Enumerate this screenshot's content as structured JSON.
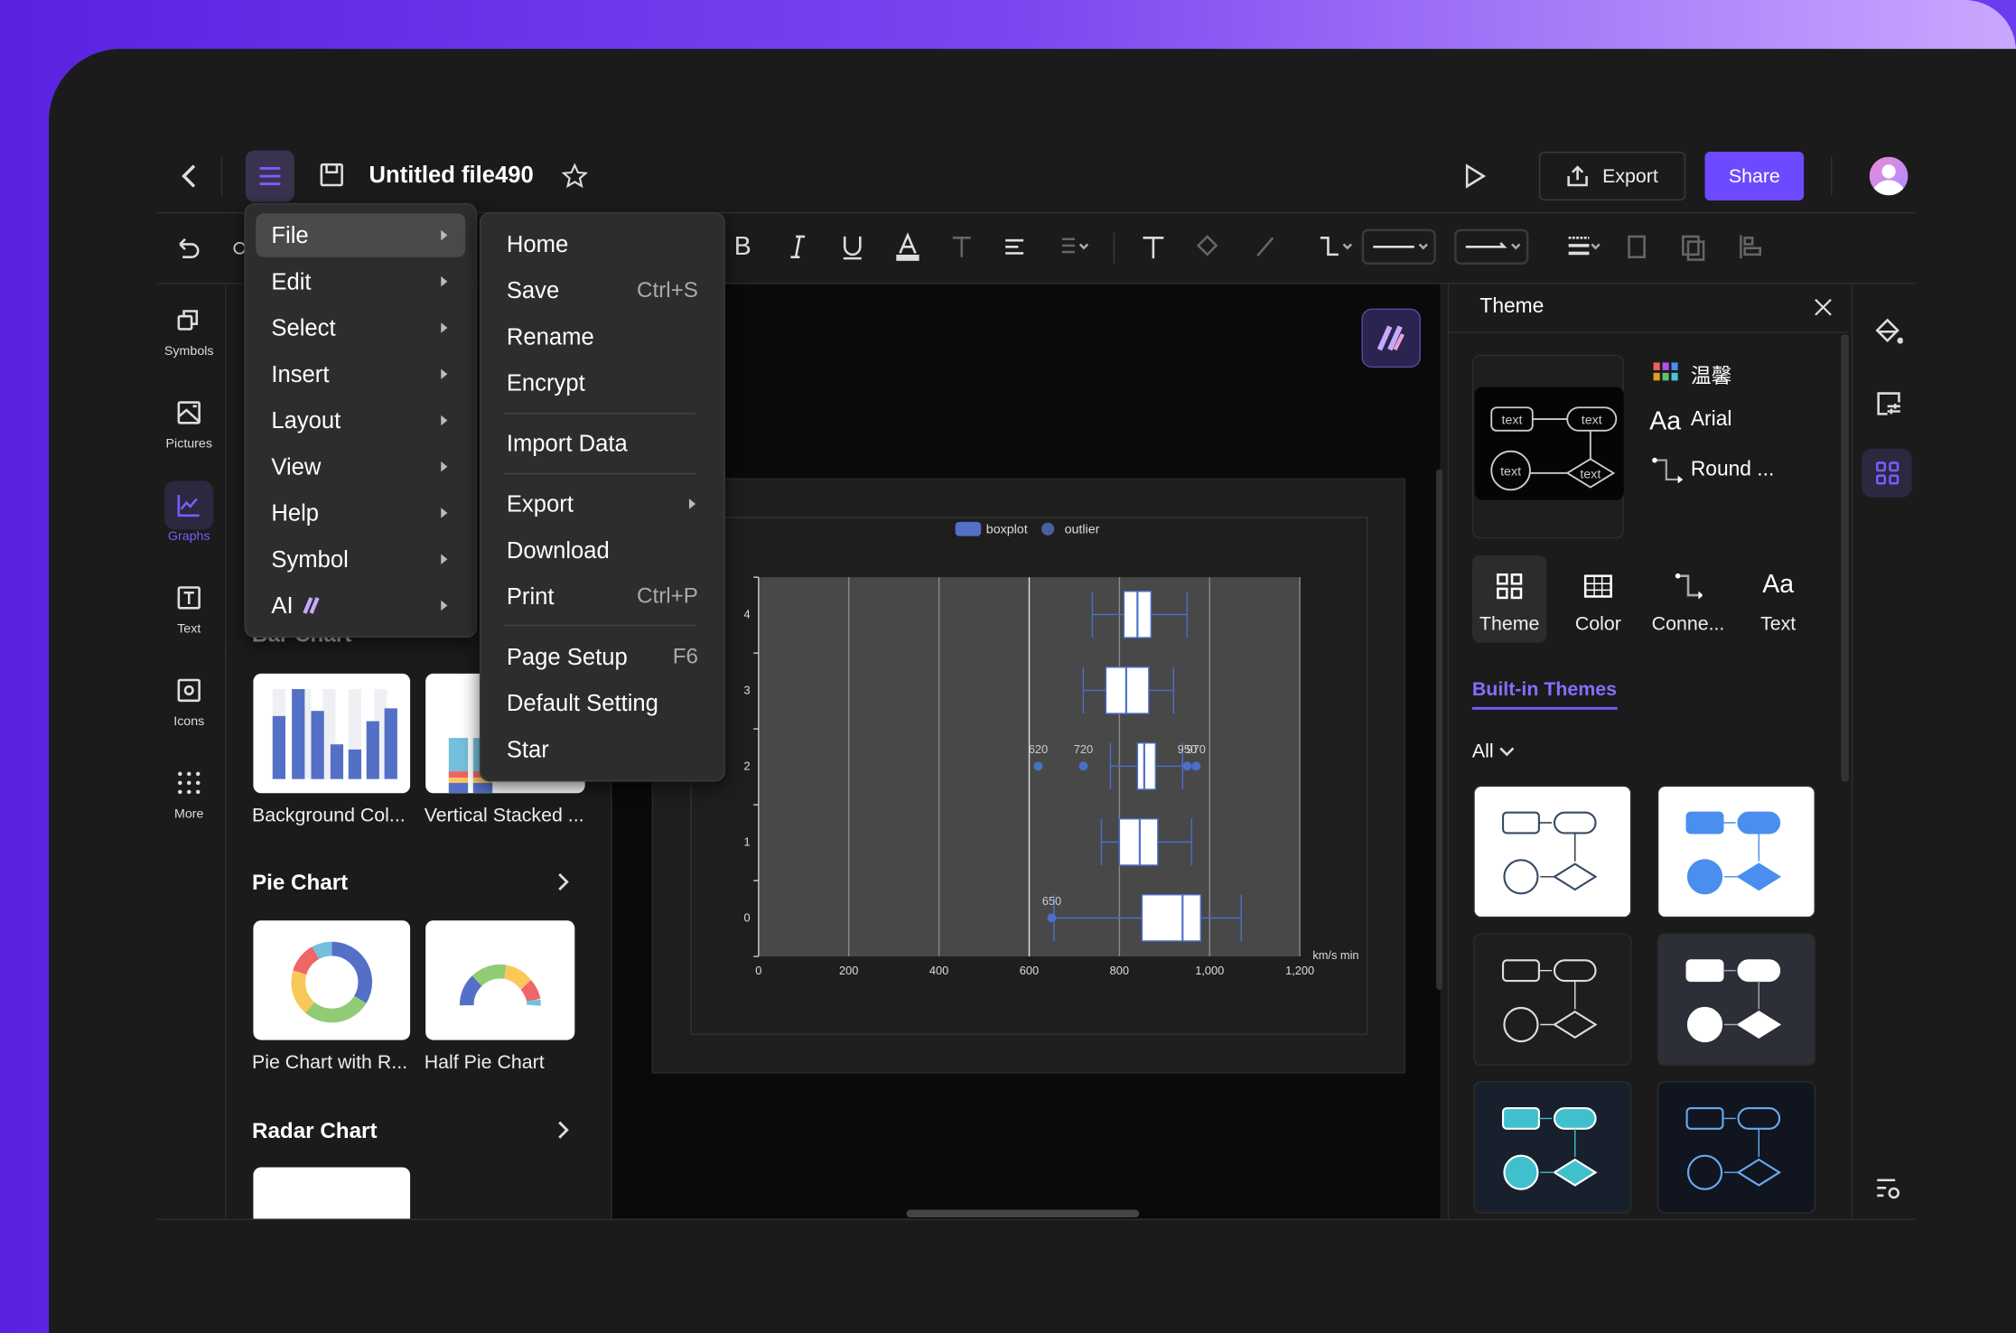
{
  "header": {
    "title": "Untitled file490",
    "export_label": "Export",
    "share_label": "Share"
  },
  "colors": {
    "accent": "#6d4aff",
    "menu_bg": "#2d2d2d",
    "canvas": "#0a0a0a",
    "plot_bg": "#484848",
    "box_stroke": "#4a6fc7",
    "outlier": "#4a6fc7"
  },
  "sidebar": {
    "items": [
      {
        "label": "Symbols",
        "icon": "symbols-icon"
      },
      {
        "label": "Pictures",
        "icon": "pictures-icon"
      },
      {
        "label": "Graphs",
        "icon": "graphs-icon",
        "active": true
      },
      {
        "label": "Text",
        "icon": "text-icon"
      },
      {
        "label": "Icons",
        "icon": "icons-icon"
      },
      {
        "label": "More",
        "icon": "more-icon"
      }
    ]
  },
  "library": {
    "bar_heading": "Bar Chart",
    "bar_items": [
      "Background Col...",
      "Vertical Stacked ..."
    ],
    "pie_heading": "Pie Chart",
    "pie_items": [
      "Pie Chart with R...",
      "Half Pie Chart"
    ],
    "radar_heading": "Radar Chart"
  },
  "main_menu": {
    "items": [
      "File",
      "Edit",
      "Select",
      "Insert",
      "Layout",
      "View",
      "Help",
      "Symbol",
      "AI"
    ],
    "highlighted": "File"
  },
  "file_menu": {
    "items": [
      {
        "label": "Home"
      },
      {
        "label": "Save",
        "shortcut": "Ctrl+S"
      },
      {
        "label": "Rename"
      },
      {
        "label": "Encrypt"
      },
      {
        "label": "Import Data"
      },
      {
        "label": "Export",
        "submenu": true
      },
      {
        "label": "Download"
      },
      {
        "label": "Print",
        "shortcut": "Ctrl+P"
      },
      {
        "label": "Page Setup",
        "shortcut": "F6"
      },
      {
        "label": "Default Setting"
      },
      {
        "label": "Star"
      }
    ]
  },
  "chart_data": {
    "type": "boxplot",
    "orientation": "horizontal",
    "legend": [
      "boxplot",
      "outlier"
    ],
    "legend_position": "top",
    "categories": [
      "0",
      "1",
      "2",
      "3",
      "4"
    ],
    "xlabel": "km/s min",
    "xlim": [
      0,
      1200
    ],
    "xticks": [
      "0",
      "200",
      "400",
      "600",
      "800",
      "1,000",
      "1,200"
    ],
    "grid": true,
    "boxes": [
      {
        "category": "0",
        "min": 655,
        "q1": 850,
        "median": 940,
        "q3": 980,
        "max": 1070
      },
      {
        "category": "1",
        "min": 760,
        "q1": 800,
        "median": 845,
        "q3": 885,
        "max": 960
      },
      {
        "category": "2",
        "min": 780,
        "q1": 840,
        "median": 855,
        "q3": 880,
        "max": 940
      },
      {
        "category": "3",
        "min": 720,
        "q1": 770,
        "median": 815,
        "q3": 865,
        "max": 920
      },
      {
        "category": "4",
        "min": 740,
        "q1": 810,
        "median": 840,
        "q3": 870,
        "max": 950
      }
    ],
    "outliers": [
      {
        "category": "0",
        "value": 650,
        "label": "650"
      },
      {
        "category": "2",
        "value": 620,
        "label": "620"
      },
      {
        "category": "2",
        "value": 720,
        "label": "720"
      },
      {
        "category": "2",
        "value": 950,
        "label": "950"
      },
      {
        "category": "2",
        "value": 970,
        "label": "970"
      }
    ]
  },
  "theme_panel": {
    "title": "Theme",
    "current_color_scheme": "温馨",
    "current_font": "Arial",
    "current_connector": "Round ...",
    "preview_node_text": "text",
    "tabs": [
      "Theme",
      "Color",
      "Conne...",
      "Text"
    ],
    "active_tab": "Theme",
    "builtin_label": "Built-in Themes",
    "filter": "All",
    "cards": [
      {
        "bg": "#ffffff",
        "stroke": "#3a4a66",
        "fill": "none",
        "line": "#333333"
      },
      {
        "bg": "#ffffff",
        "stroke": "#4a8ef0",
        "fill": "#4a8ef0",
        "line": "#4a8ef0"
      },
      {
        "bg": "#1e1e1e",
        "stroke": "#dddddd",
        "fill": "none",
        "line": "#dddddd"
      },
      {
        "bg": "#2c2e38",
        "stroke": "#ffffff",
        "fill": "#ffffff",
        "line": "#aaaaaa"
      },
      {
        "bg": "#17202c",
        "stroke": "#ffffff",
        "fill": "#40c0cc",
        "line": "#40c0cc"
      },
      {
        "bg": "#10151f",
        "stroke": "#6aa8f0",
        "fill": "none",
        "line": "#6aa8f0"
      }
    ]
  }
}
